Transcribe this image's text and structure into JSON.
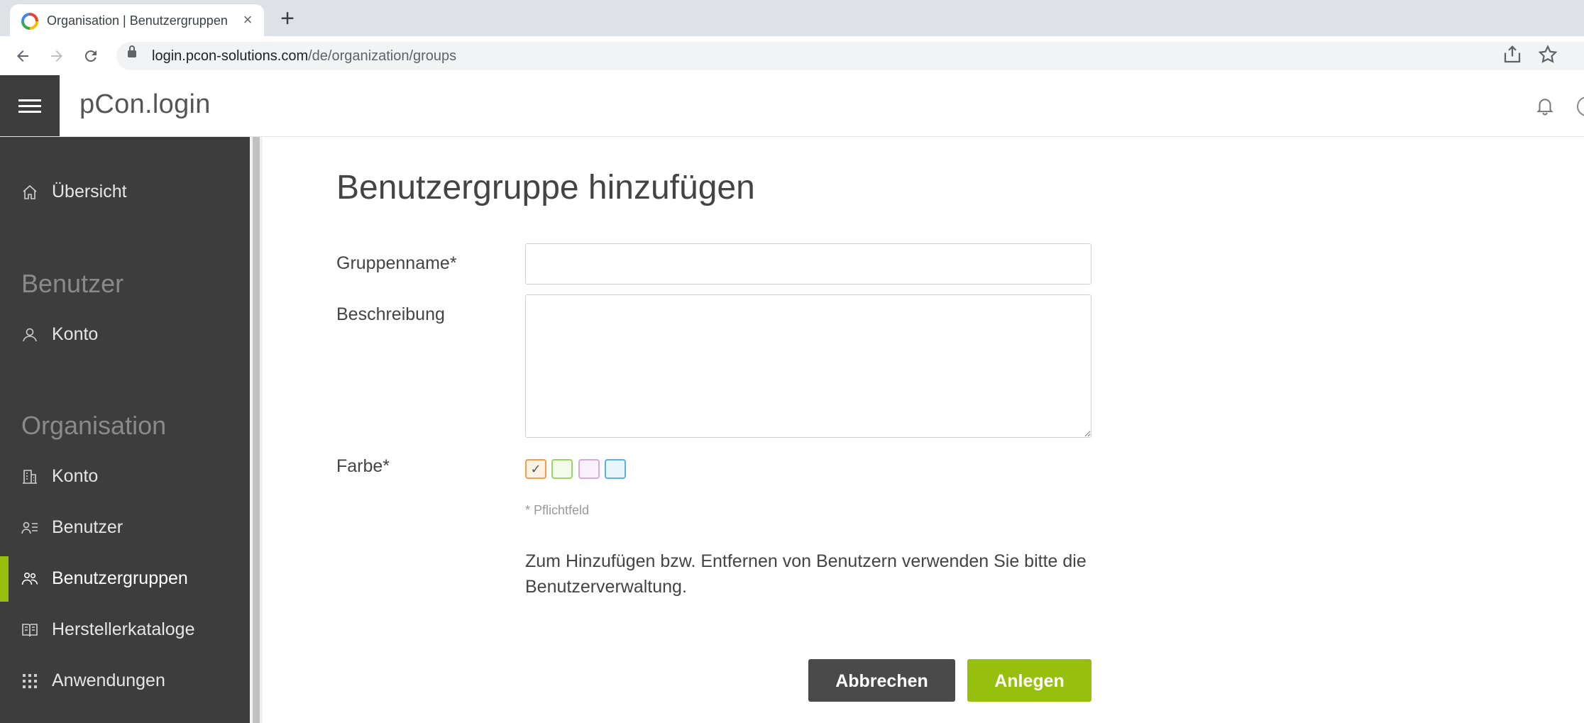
{
  "browser": {
    "tab_title": "Organisation | Benutzergruppen",
    "tab_close": "×",
    "new_tab": "+",
    "url_host": "login.pcon-solutions.com",
    "url_path": "/de/organization/groups"
  },
  "app": {
    "title": "pCon.login"
  },
  "sidebar": {
    "overview": {
      "label": "Übersicht",
      "icon": "home-icon"
    },
    "section_user": "Benutzer",
    "user_items": [
      {
        "label": "Konto",
        "icon": "person-icon"
      }
    ],
    "section_org": "Organisation",
    "org_items": [
      {
        "label": "Konto",
        "icon": "building-icon"
      },
      {
        "label": "Benutzer",
        "icon": "user-list-icon"
      },
      {
        "label": "Benutzergruppen",
        "icon": "group-icon",
        "active": true
      },
      {
        "label": "Herstellerkataloge",
        "icon": "catalog-icon"
      },
      {
        "label": "Anwendungen",
        "icon": "apps-grid-icon"
      }
    ]
  },
  "form": {
    "title": "Benutzergruppe hinzufügen",
    "group_name_label": "Gruppenname*",
    "group_name_value": "",
    "description_label": "Beschreibung",
    "description_value": "",
    "color_label": "Farbe*",
    "colors": [
      {
        "border": "#f0a04b",
        "fill": "#fdf1e4",
        "selected": true,
        "mark": "✓"
      },
      {
        "border": "#9ad36a",
        "fill": "#f1fbe9",
        "selected": false,
        "mark": ""
      },
      {
        "border": "#d7a9e0",
        "fill": "#faf1fc",
        "selected": false,
        "mark": ""
      },
      {
        "border": "#55b5dc",
        "fill": "#e8f6fc",
        "selected": false,
        "mark": ""
      }
    ],
    "required_note": "* Pflichtfeld",
    "info_text": "Zum Hinzufügen bzw. Entfernen von Benutzern verwenden Sie bitte die Benutzerverwaltung.",
    "cancel_label": "Abbrechen",
    "create_label": "Anlegen"
  },
  "colors": {
    "accent": "#97bf0d",
    "sidebar_bg": "#3d3d3d",
    "cancel_bg": "#4a4a4a"
  }
}
